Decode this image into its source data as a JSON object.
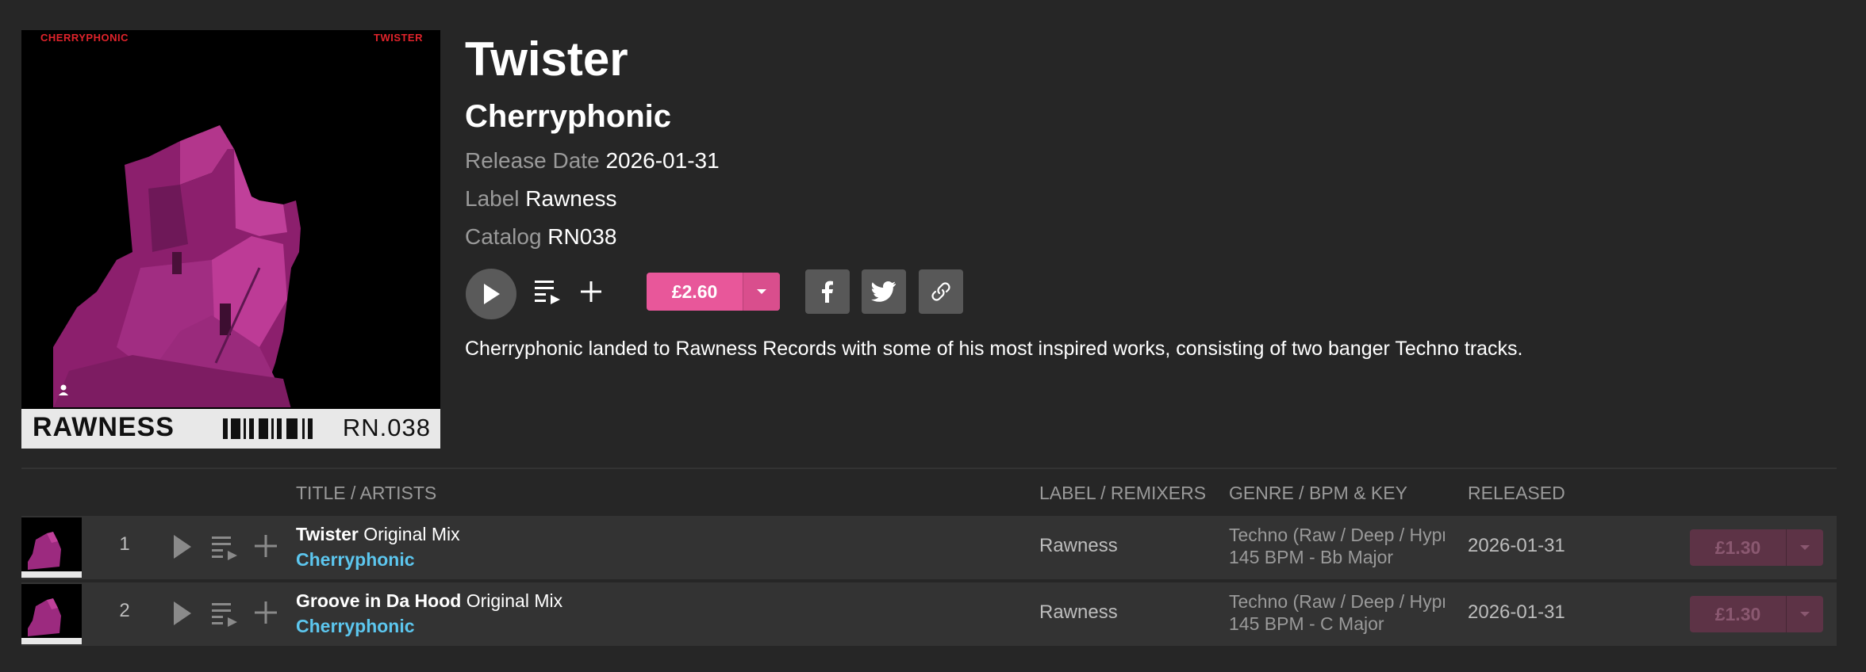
{
  "release": {
    "title": "Twister",
    "artist": "Cherryphonic",
    "release_date_label": "Release Date",
    "release_date": "2026-01-31",
    "label_label": "Label",
    "label": "Rawness",
    "catalog_label": "Catalog",
    "catalog": "RN038",
    "price": "£2.60",
    "description": "Cherryphonic landed to Rawness Records with some of his most inspired works, consisting of two banger Techno tracks."
  },
  "cover": {
    "top_left_text": "CHERRYPHONIC",
    "top_right_text": "TWISTER",
    "brand": "RAWNESS",
    "catalog_text": "RN.038"
  },
  "table": {
    "headers": {
      "title": "TITLE / ARTISTS",
      "label": "LABEL / REMIXERS",
      "genre": "GENRE / BPM & KEY",
      "released": "RELEASED"
    },
    "rows": [
      {
        "number": "1",
        "title": "Twister",
        "mix": "Original Mix",
        "artist": "Cherryphonic",
        "label": "Rawness",
        "genre": "Techno (Raw / Deep / Hypnotic)",
        "bpm_key": "145 BPM - Bb Major",
        "released": "2026-01-31",
        "price": "£1.30"
      },
      {
        "number": "2",
        "title": "Groove in Da Hood",
        "mix": "Original Mix",
        "artist": "Cherryphonic",
        "label": "Rawness",
        "genre": "Techno (Raw / Deep / Hypnotic)",
        "bpm_key": "145 BPM - C Major",
        "released": "2026-01-31",
        "price": "£1.30"
      }
    ]
  },
  "colors": {
    "background": "#262626",
    "accent_pink": "#e8579a",
    "artist_link": "#5cc6ee",
    "row_bg": "#333333"
  },
  "icons": [
    "play-icon",
    "queue-icon",
    "add-icon",
    "chevron-down-icon",
    "facebook-icon",
    "twitter-icon",
    "link-icon",
    "person-icon"
  ]
}
